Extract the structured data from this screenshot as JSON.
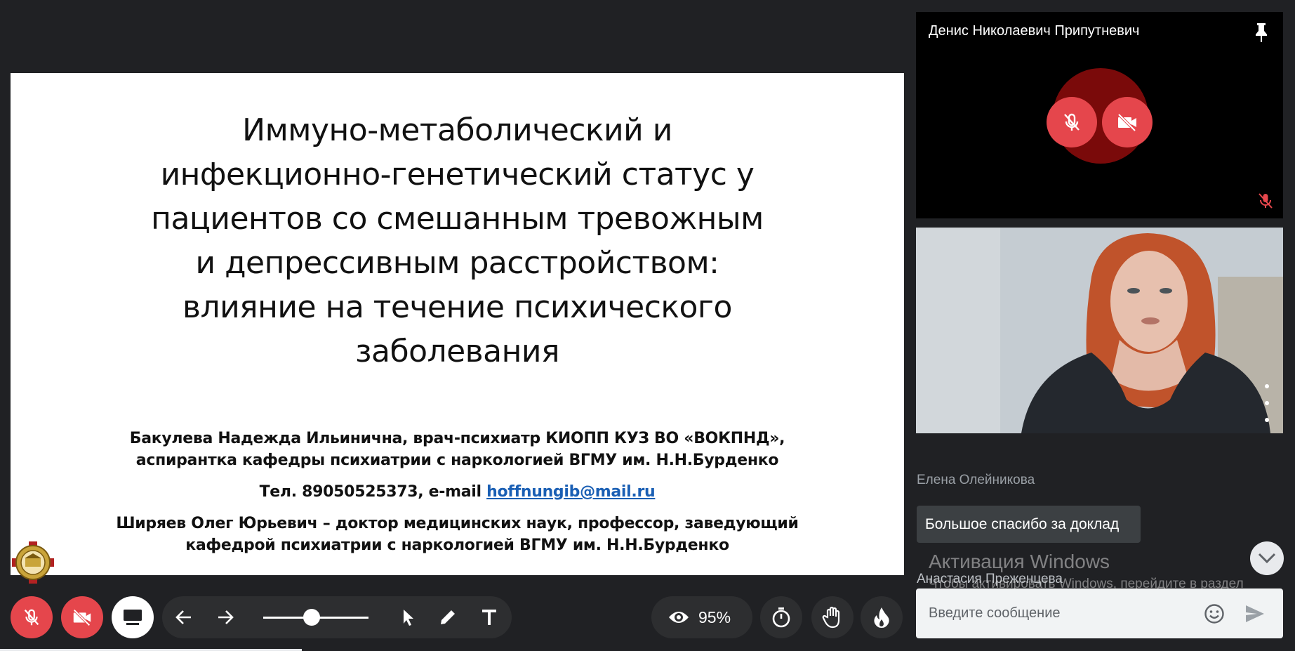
{
  "slide": {
    "title_lines": [
      "Иммуно-метаболический и",
      "инфекционно-генетический статус у",
      "пациентов со смешанным тревожным",
      "и депрессивным расстройством:",
      "влияние на течение психического",
      "заболевания"
    ],
    "author1_line1": "Бакулева Надежда Ильинична, врач-психиатр КИОПП КУЗ ВО «ВОКПНД»,",
    "author1_line2": "аспирантка кафедры психиатрии с наркологией ВГМУ им. Н.Н.Бурденко",
    "contact_prefix": "Тел. 89050525373, e-mail ",
    "contact_email": "hoffnungib@mail.ru",
    "author2_line1": "Ширяев Олег Юрьевич – доктор медицинских наук, профессор, заведующий",
    "author2_line2": "кафедрой психиатрии с наркологией ВГМУ им. Н.Н.Бурденко"
  },
  "participants": {
    "top_tile_name": "Денис Николаевич Припутневич",
    "avatar_color": "#7a0a0a",
    "muted_color": "#e5464c"
  },
  "chat": {
    "messages": [
      {
        "author": "Елена Олейникова",
        "text": "Большое спасибо за доклад"
      }
    ],
    "next_author": "Анастасия Преженцева",
    "input_placeholder": "Введите сообщение"
  },
  "watermark": {
    "title": "Активация Windows",
    "text": "Чтобы активировать Windows, перейдите в раздел \"Параметры\"."
  },
  "toolbar": {
    "zoom_fraction": 0.46,
    "visibility_percent": "95%",
    "icons": [
      "mic-off-icon",
      "camera-off-icon",
      "screen-share-icon",
      "arrow-left-icon",
      "arrow-right-icon",
      "cursor-icon",
      "pencil-icon",
      "text-icon",
      "eye-icon",
      "timer-icon",
      "hand-icon",
      "fire-icon"
    ]
  }
}
